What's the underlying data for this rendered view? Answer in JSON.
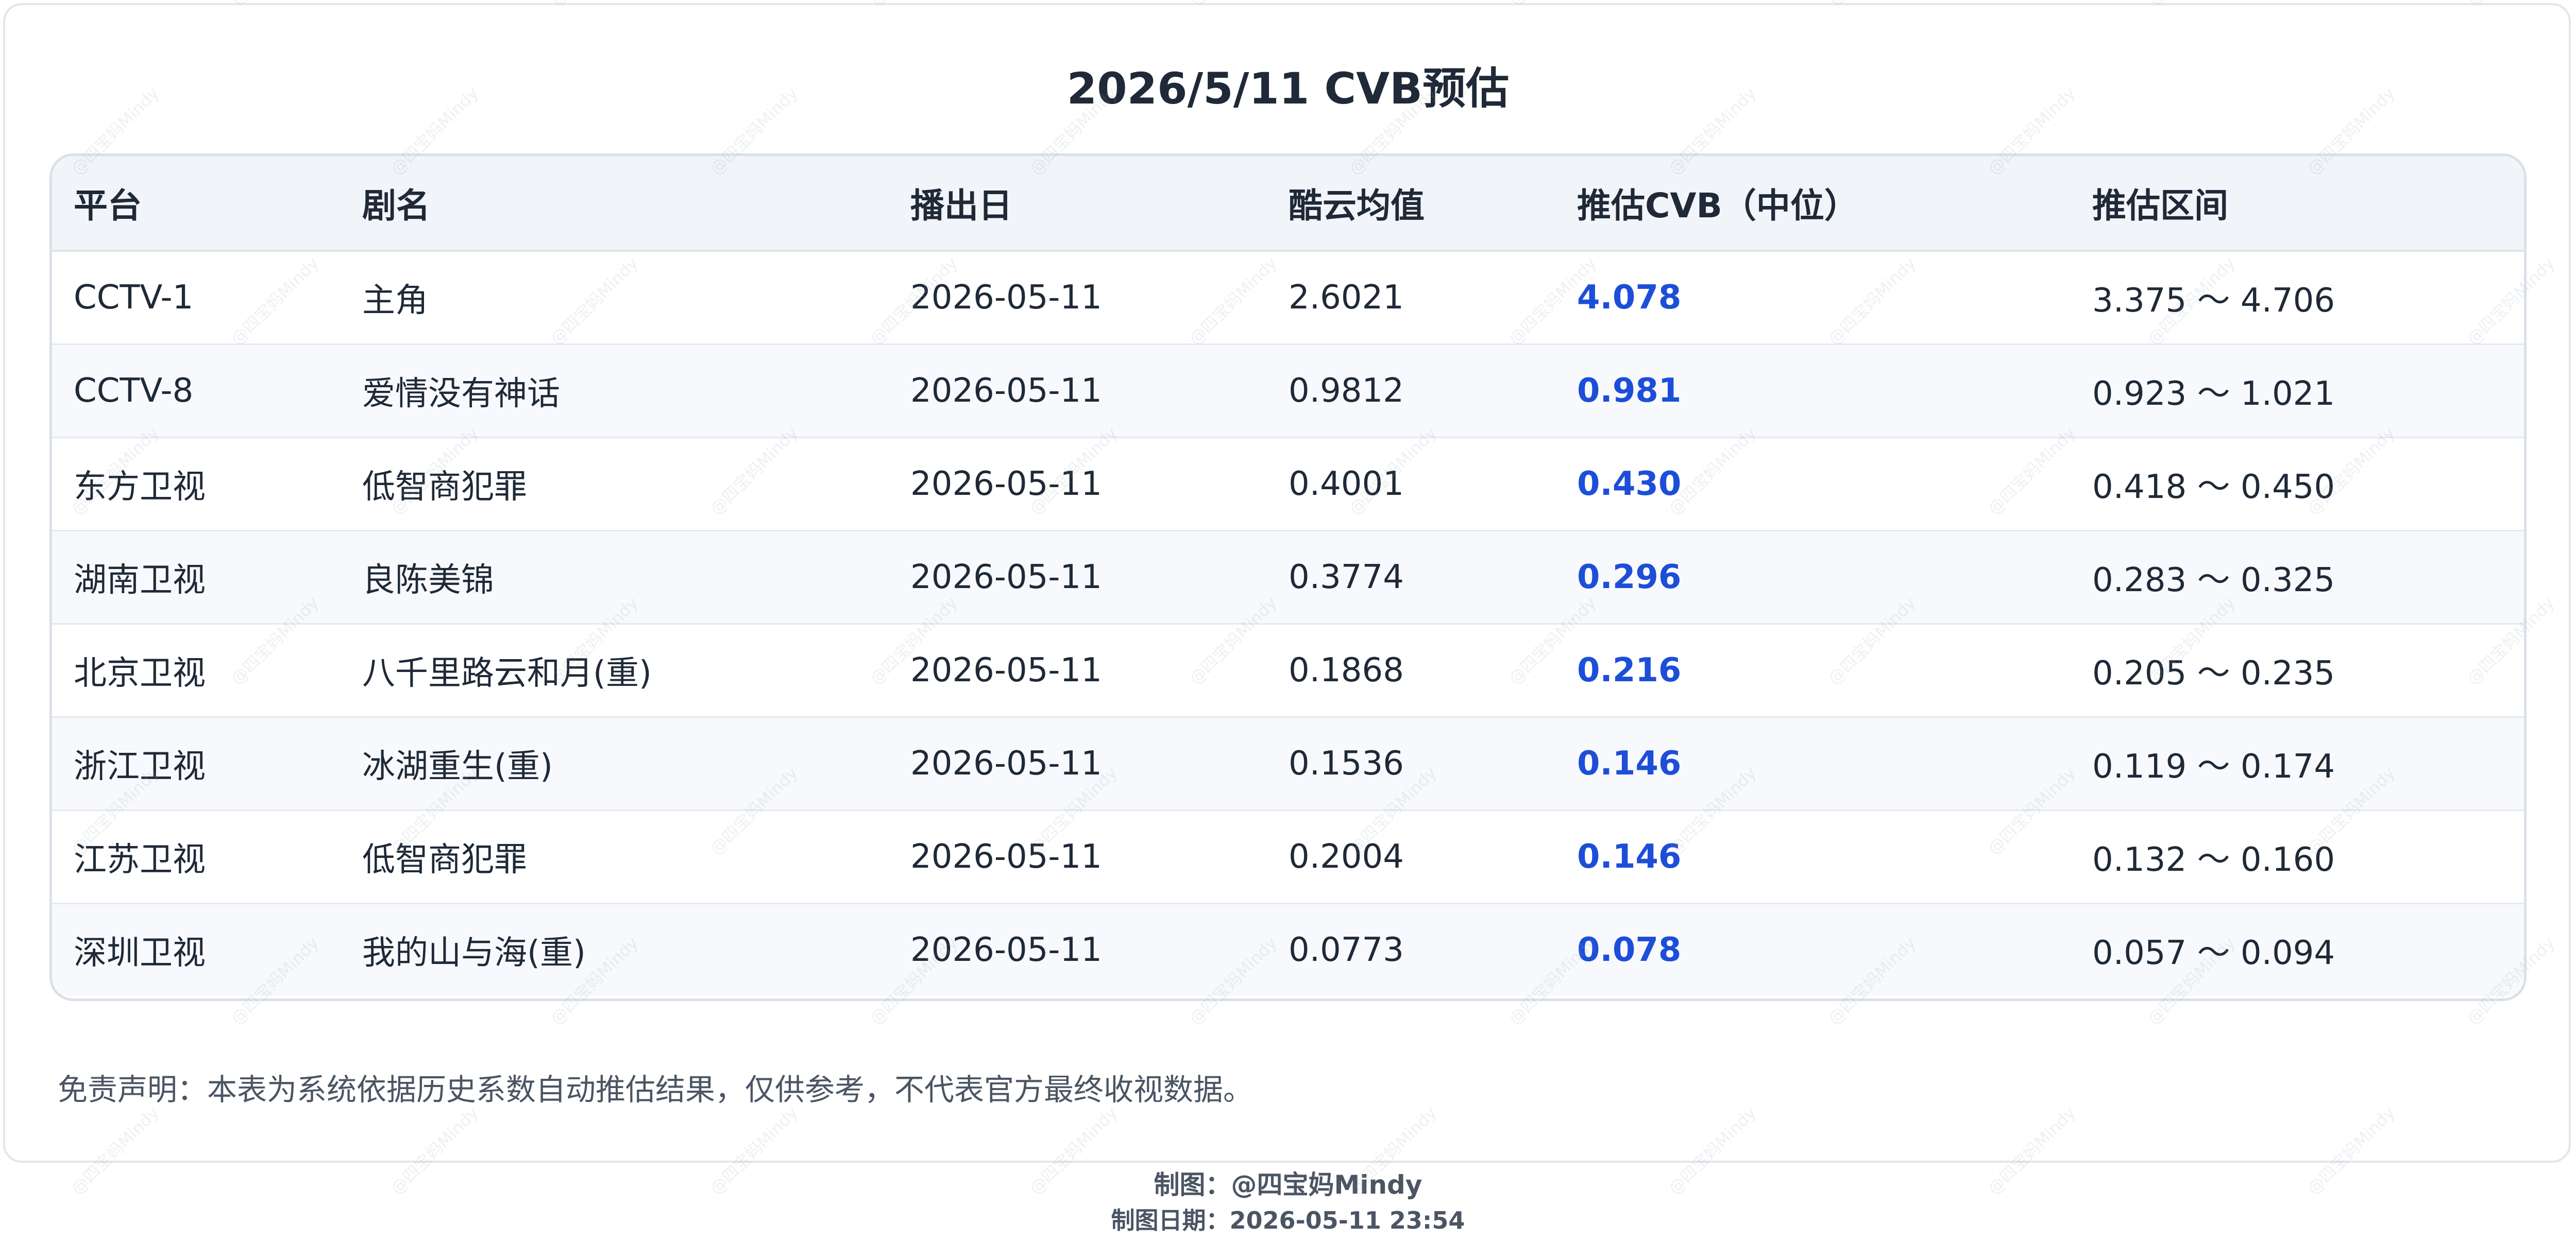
{
  "title": "2026/5/11 CVB预估",
  "table": {
    "headers": [
      "平台",
      "剧名",
      "播出日",
      "酷云均值",
      "推估CVB（中位）",
      "推估区间"
    ],
    "rows": [
      [
        "CCTV-1",
        "主角",
        "2026-05-11",
        "2.6021",
        "4.078",
        "3.375 ～ 4.706"
      ],
      [
        "CCTV-8",
        "爱情没有神话",
        "2026-05-11",
        "0.9812",
        "0.981",
        "0.923 ～ 1.021"
      ],
      [
        "东方卫视",
        "低智商犯罪",
        "2026-05-11",
        "0.4001",
        "0.430",
        "0.418 ～ 0.450"
      ],
      [
        "湖南卫视",
        "良陈美锦",
        "2026-05-11",
        "0.3774",
        "0.296",
        "0.283 ～ 0.325"
      ],
      [
        "北京卫视",
        "八千里路云和月(重)",
        "2026-05-11",
        "0.1868",
        "0.216",
        "0.205 ～ 0.235"
      ],
      [
        "浙江卫视",
        "冰湖重生(重)",
        "2026-05-11",
        "0.1536",
        "0.146",
        "0.119 ～ 0.174"
      ],
      [
        "江苏卫视",
        "低智商犯罪",
        "2026-05-11",
        "0.2004",
        "0.146",
        "0.132 ～ 0.160"
      ],
      [
        "深圳卫视",
        "我的山与海(重)",
        "2026-05-11",
        "0.0773",
        "0.078",
        "0.057 ～ 0.094"
      ]
    ]
  },
  "disclaimer": "免责声明：本表为系统依据历史系数自动推估结果，仅供参考，不代表官方最终收视数据。",
  "credit": "制图：@四宝妈Mindy",
  "credit_date": "制图日期：2026-05-11 23:54",
  "watermark_text": "@四宝妈Mindy",
  "colors": {
    "accent_value": "#1d4ed8",
    "header_bg": "#f1f4f8",
    "border": "#dbe1e8"
  }
}
